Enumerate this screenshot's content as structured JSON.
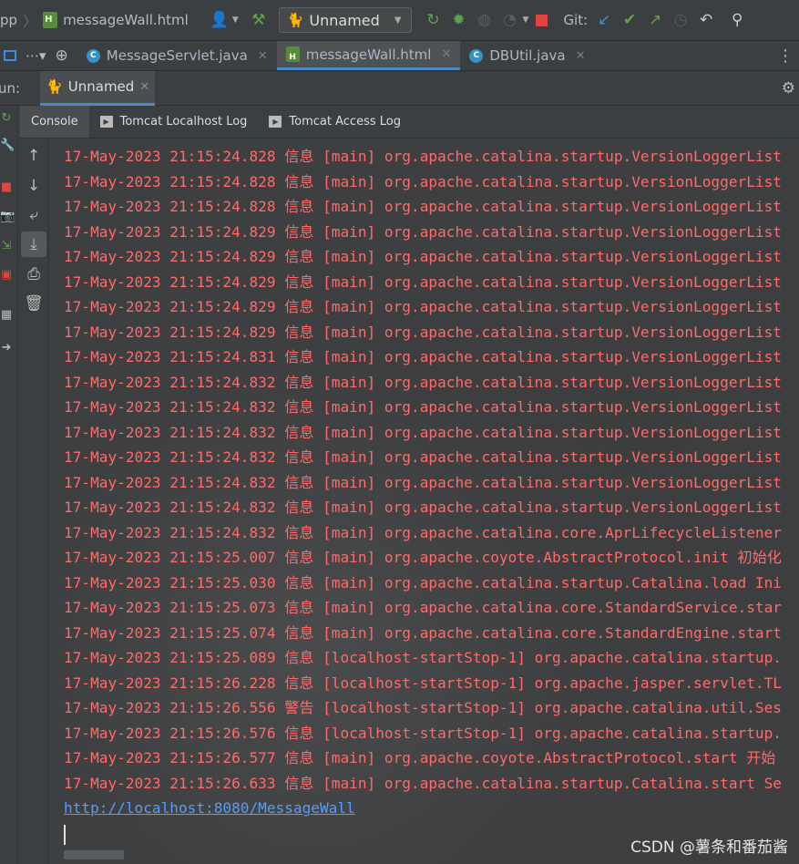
{
  "toolbar": {
    "project_fragment": "pp",
    "file": "messageWall.html",
    "run_config": "Unnamed",
    "git_label": "Git:",
    "icons": [
      "user-icon",
      "hammer-icon",
      "rerun-icon",
      "debug-icon",
      "coverage-icon",
      "profile-icon",
      "stop-icon",
      "git-update-icon",
      "git-commit-icon",
      "git-push-icon",
      "history-icon",
      "rollback-icon",
      "search-icon"
    ]
  },
  "tabs": [
    {
      "label": "MessageServlet.java",
      "type": "java",
      "active": false
    },
    {
      "label": "messageWall.html",
      "type": "html",
      "active": true
    },
    {
      "label": "DBUtil.java",
      "type": "java",
      "active": false
    }
  ],
  "run": {
    "label": "un:",
    "tab": "Unnamed"
  },
  "subtabs": [
    {
      "label": "Console",
      "active": true
    },
    {
      "label": "Tomcat Localhost Log",
      "active": false
    },
    {
      "label": "Tomcat Access Log",
      "active": false
    }
  ],
  "console": {
    "lines": [
      "17-May-2023 21:15:24.828 信息 [main] org.apache.catalina.startup.VersionLoggerList",
      "17-May-2023 21:15:24.828 信息 [main] org.apache.catalina.startup.VersionLoggerList",
      "17-May-2023 21:15:24.828 信息 [main] org.apache.catalina.startup.VersionLoggerList",
      "17-May-2023 21:15:24.829 信息 [main] org.apache.catalina.startup.VersionLoggerList",
      "17-May-2023 21:15:24.829 信息 [main] org.apache.catalina.startup.VersionLoggerList",
      "17-May-2023 21:15:24.829 信息 [main] org.apache.catalina.startup.VersionLoggerList",
      "17-May-2023 21:15:24.829 信息 [main] org.apache.catalina.startup.VersionLoggerList",
      "17-May-2023 21:15:24.829 信息 [main] org.apache.catalina.startup.VersionLoggerList",
      "17-May-2023 21:15:24.831 信息 [main] org.apache.catalina.startup.VersionLoggerList",
      "17-May-2023 21:15:24.832 信息 [main] org.apache.catalina.startup.VersionLoggerList",
      "17-May-2023 21:15:24.832 信息 [main] org.apache.catalina.startup.VersionLoggerList",
      "17-May-2023 21:15:24.832 信息 [main] org.apache.catalina.startup.VersionLoggerList",
      "17-May-2023 21:15:24.832 信息 [main] org.apache.catalina.startup.VersionLoggerList",
      "17-May-2023 21:15:24.832 信息 [main] org.apache.catalina.startup.VersionLoggerList",
      "17-May-2023 21:15:24.832 信息 [main] org.apache.catalina.startup.VersionLoggerList",
      "17-May-2023 21:15:24.832 信息 [main] org.apache.catalina.core.AprLifecycleListener",
      "17-May-2023 21:15:25.007 信息 [main] org.apache.coyote.AbstractProtocol.init 初始化",
      "17-May-2023 21:15:25.030 信息 [main] org.apache.catalina.startup.Catalina.load Ini",
      "17-May-2023 21:15:25.073 信息 [main] org.apache.catalina.core.StandardService.star",
      "17-May-2023 21:15:25.074 信息 [main] org.apache.catalina.core.StandardEngine.start",
      "17-May-2023 21:15:25.089 信息 [localhost-startStop-1] org.apache.catalina.startup.",
      "17-May-2023 21:15:26.228 信息 [localhost-startStop-1] org.apache.jasper.servlet.TL",
      "17-May-2023 21:15:26.556 警告 [localhost-startStop-1] org.apache.catalina.util.Ses",
      "17-May-2023 21:15:26.576 信息 [localhost-startStop-1] org.apache.catalina.startup.",
      "17-May-2023 21:15:26.577 信息 [main] org.apache.coyote.AbstractProtocol.start 开始",
      "17-May-2023 21:15:26.633 信息 [main] org.apache.catalina.startup.Catalina.start Se"
    ],
    "link": "http://localhost:8080/MessageWall"
  },
  "watermark": "CSDN @薯条和番茄酱"
}
